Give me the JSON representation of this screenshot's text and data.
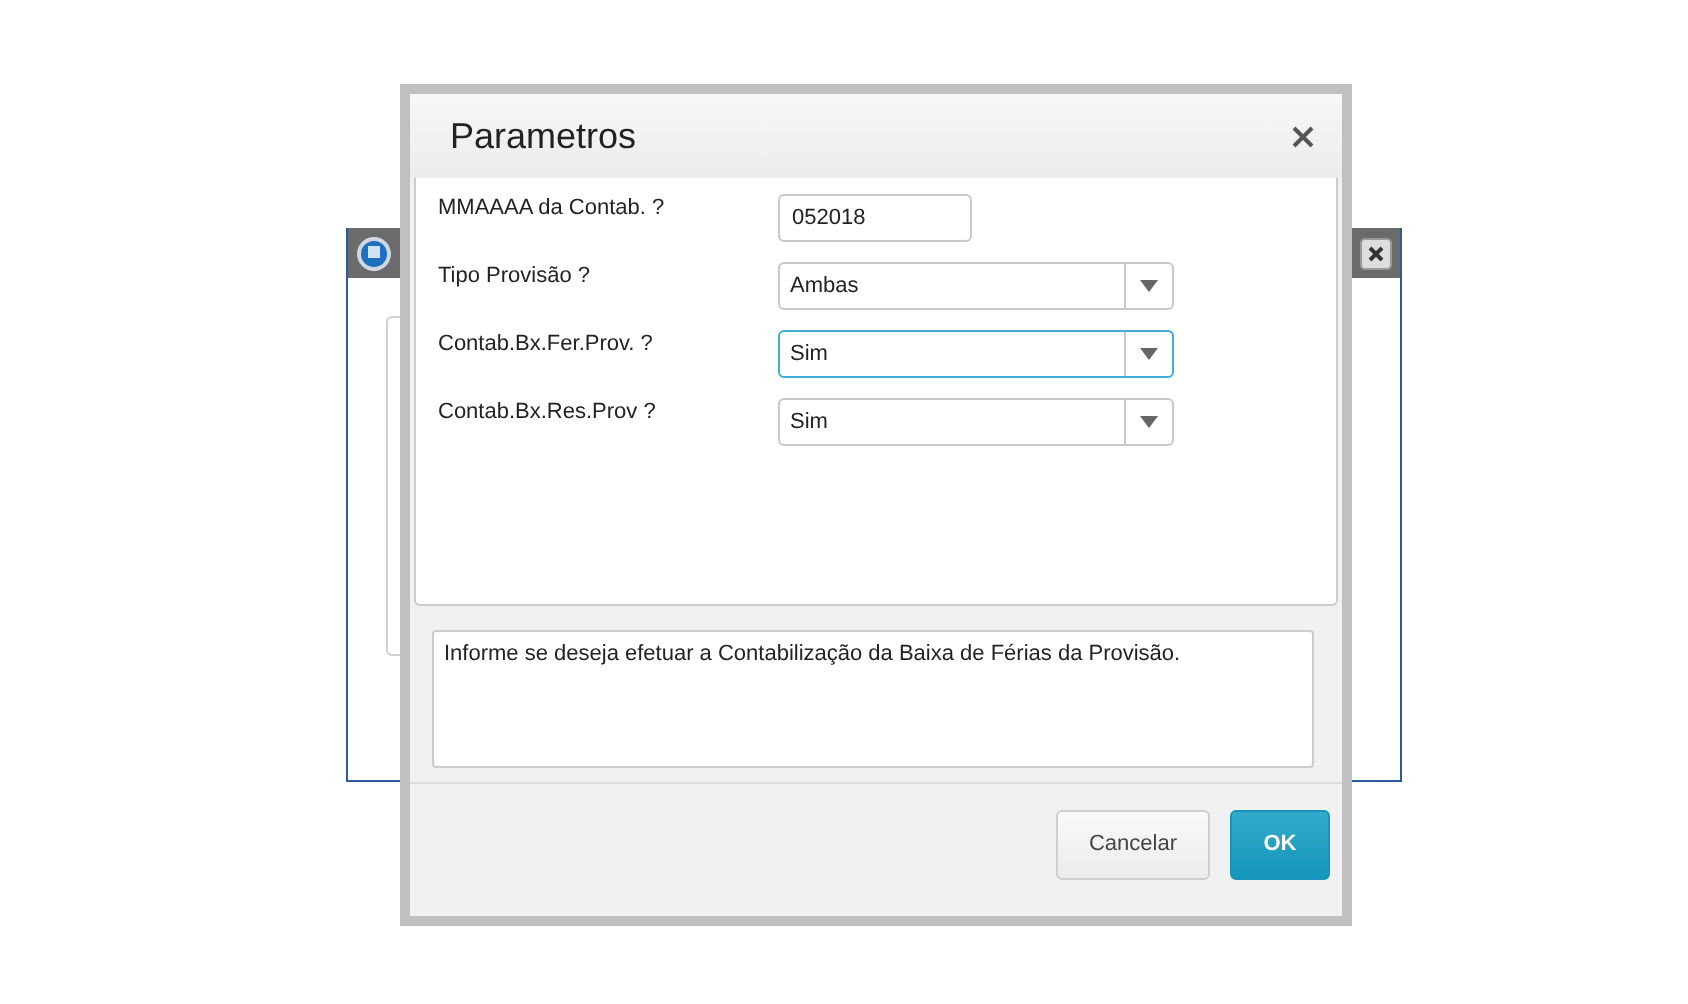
{
  "dialog": {
    "title": "Parametros"
  },
  "fields": [
    {
      "label": "MMAAAA da Contab. ?",
      "kind": "text",
      "value": "052018",
      "focused": false
    },
    {
      "label": "Tipo Provisão ?",
      "kind": "select",
      "value": "Ambas",
      "focused": false
    },
    {
      "label": "Contab.Bx.Fer.Prov. ?",
      "kind": "select",
      "value": "Sim",
      "focused": true
    },
    {
      "label": "Contab.Bx.Res.Prov ?",
      "kind": "select",
      "value": "Sim",
      "focused": false
    }
  ],
  "help_text": "Informe se deseja efetuar a Contabilização da Baixa de Férias da Provisão.",
  "buttons": [
    {
      "label": "Cancelar",
      "kind": "secondary"
    },
    {
      "label": "OK",
      "kind": "primary"
    }
  ]
}
